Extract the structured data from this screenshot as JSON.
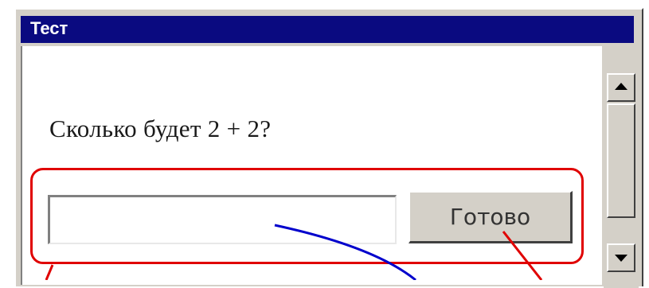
{
  "window": {
    "title": "Тест"
  },
  "question": {
    "text": "Сколько будет 2 + 2?"
  },
  "answer": {
    "value": "",
    "placeholder": ""
  },
  "submit": {
    "label": "Готово"
  },
  "annotations": {
    "box_color": "#e00000",
    "arrow_colors": [
      "#e00000",
      "#0000cc"
    ]
  }
}
